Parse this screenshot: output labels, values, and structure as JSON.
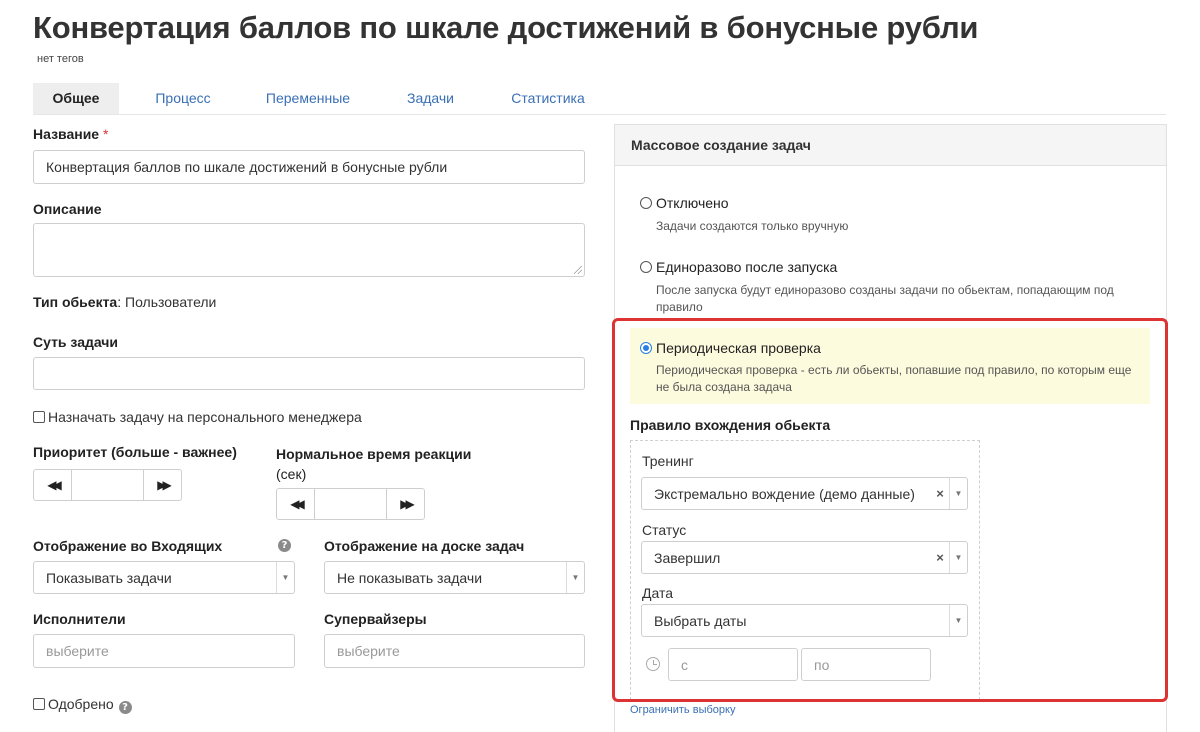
{
  "header": {
    "title": "Конвертация баллов по шкале достижений в бонусные рубли",
    "tags": "нет тегов"
  },
  "tabs": [
    {
      "label": "Общее",
      "active": true
    },
    {
      "label": "Процесс",
      "active": false
    },
    {
      "label": "Переменные",
      "active": false
    },
    {
      "label": "Задачи",
      "active": false
    },
    {
      "label": "Статистика",
      "active": false
    }
  ],
  "form": {
    "name_label": "Название",
    "required_mark": "*",
    "name_value": "Конвертация баллов по шкале достижений в бонусные рубли",
    "description_label": "Описание",
    "object_type_label": "Тип обьекта",
    "object_type_sep": ":",
    "object_type_value": "Пользователи",
    "task_essence_label": "Суть задачи",
    "assign_manager_label": "Назначать задачу на персонального менеджера",
    "priority_label": "Приоритет (больше - важнее)",
    "reaction_time_label_1": "Нормальное время реакции",
    "reaction_time_label_2": "(сек)",
    "inbox_display_label": "Отображение во Входящих",
    "inbox_display_value": "Показывать задачи",
    "board_display_label": "Отображение на доске задач",
    "board_display_value": "Не показывать задачи",
    "executors_label": "Исполнители",
    "executors_placeholder": "выберите",
    "supervisors_label": "Супервайзеры",
    "supervisors_placeholder": "выберите",
    "approved_label": "Одобрено",
    "help_glyph": "?",
    "dec_glyph": "◀◀",
    "inc_glyph": "▶▶"
  },
  "mass_panel": {
    "title": "Массовое создание задач",
    "options": [
      {
        "label": "Отключено",
        "hint": "Задачи создаются только вручную",
        "selected": false
      },
      {
        "label": "Единоразово после запуска",
        "hint": "После запуска будут единоразово созданы задачи по обьектам, попадающим под правило",
        "selected": false
      },
      {
        "label": "Периодическая проверка",
        "hint": "Периодическая проверка - есть ли обьекты, попавшие под правило, по которым еще не была создана задача",
        "selected": true
      }
    ],
    "rule_title": "Правило вхождения обьекта",
    "training_label": "Тренинг",
    "training_value": "Экстремально вождение (демо данные)",
    "status_label": "Статус",
    "status_value": "Завершил",
    "date_label": "Дата",
    "date_value": "Выбрать даты",
    "date_from_placeholder": "с",
    "date_to_placeholder": "по",
    "limit_link": "Ограничить выборку",
    "clear_glyph": "×",
    "arrow_glyph": "▼"
  },
  "colors": {
    "accent": "#2a7de1",
    "link": "#3a6fb5",
    "highlight_box": "#dd3333",
    "selected_option_bg": "#fdfbdd"
  }
}
